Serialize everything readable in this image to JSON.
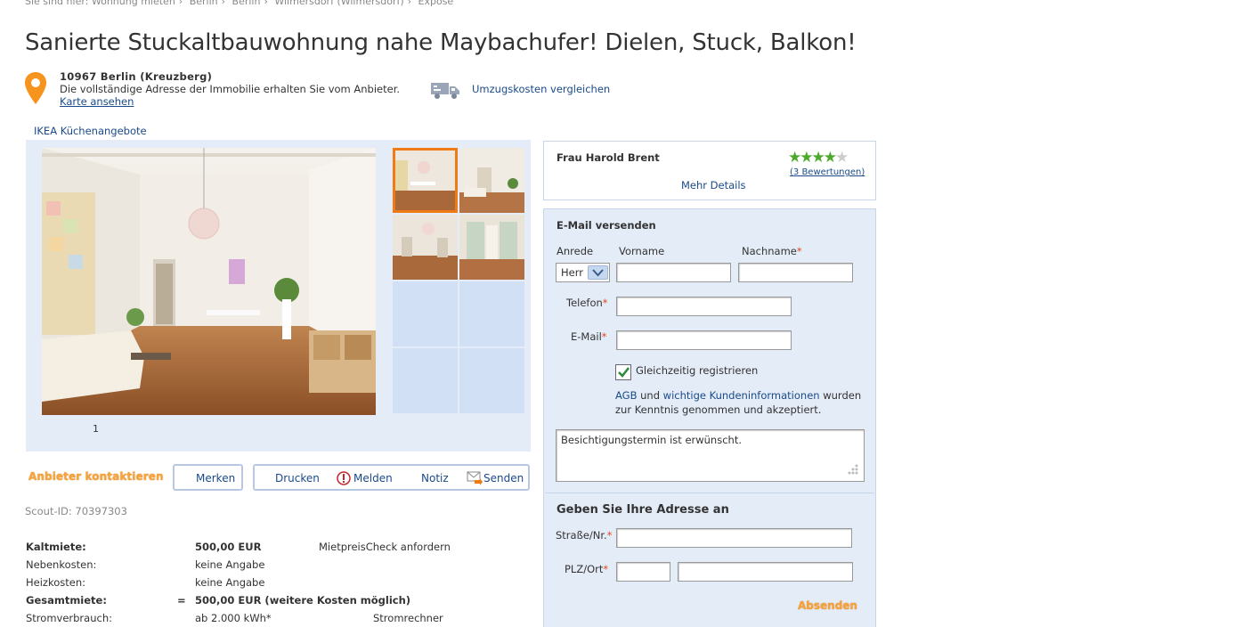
{
  "breadcrumb": {
    "prefix": "Sie sind hier:",
    "items": [
      "Wohnung mieten",
      "Berlin",
      "Berlin",
      "Wilmersdorf (Wilmersdorf)",
      "Exposé"
    ]
  },
  "listing": {
    "title": "Sanierte Stuckaltbauwohnung nahe Maybachufer! Dielen, Stuck, Balkon!",
    "zip_city": "10967 Berlin (Kreuzberg)",
    "address_note": "Die vollständige Adresse der Immobilie erhalten Sie vom Anbieter.",
    "map_link": "Karte ansehen",
    "moving_link": "Umzugskosten vergleichen",
    "ikea_link": "IKEA Küchenangebote",
    "image_counter": "1",
    "scout_id": "Scout-ID: 70397303"
  },
  "actions": {
    "contact": "Anbieter kontaktieren",
    "remember": "Merken",
    "print": "Drucken",
    "report": "Melden",
    "note": "Notiz",
    "send": "Senden"
  },
  "costs": [
    {
      "label": "Kaltmiete:",
      "eq": "",
      "value": "500,00 EUR",
      "link": "MietpreisCheck anfordern",
      "bold": true
    },
    {
      "label": "Nebenkosten:",
      "eq": "",
      "value": "keine Angabe",
      "link": "",
      "bold": false
    },
    {
      "label": "Heizkosten:",
      "eq": "",
      "value": "keine Angabe",
      "link": "",
      "bold": false
    },
    {
      "label": "Gesamtmiete:",
      "eq": "=",
      "value": "500,00 EUR (weitere Kosten möglich)",
      "link": "",
      "bold": true
    },
    {
      "label": "Stromverbrauch:",
      "eq": "",
      "value": "ab 2.000 kWh*",
      "link": "Stromrechner",
      "bold": false
    }
  ],
  "agent": {
    "name": "Frau Harold Brent",
    "rating_stars": 4,
    "rating_max": 5,
    "rating_link": "(3 Bewertungen)",
    "more_details": "Mehr Details"
  },
  "email_form": {
    "heading": "E-Mail versenden",
    "salutation_label": "Anrede",
    "salutation_value": "Herr",
    "firstname_label": "Vorname",
    "lastname_label": "Nachname",
    "phone_label": "Telefon",
    "email_label": "E-Mail",
    "register_label": "Gleichzeitig registrieren",
    "register_checked": true,
    "terms_agb": "AGB",
    "terms_and": "und",
    "terms_info": "wichtige Kundeninformationen",
    "terms_rest1": "wurden",
    "terms_rest2": "zur Kenntnis genommen und akzeptiert.",
    "message": "Besichtigungstermin ist erwünscht.",
    "address_heading": "Geben Sie Ihre Adresse an",
    "street_label": "Straße/Nr.",
    "city_label": "PLZ/Ort",
    "submit": "Absenden",
    "required_mark": "*"
  },
  "colors": {
    "accent_orange": "#f07a14",
    "link_blue": "#1a4a8a",
    "panel_blue": "#e4ecf8",
    "star_green": "#4aaa2a"
  }
}
